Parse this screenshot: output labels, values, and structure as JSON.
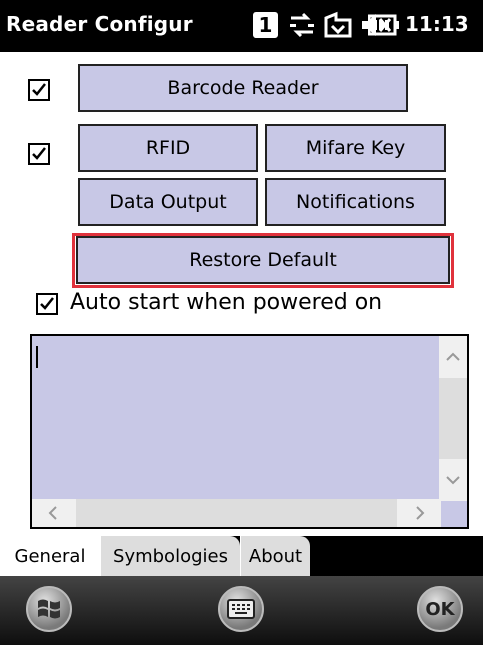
{
  "status_bar": {
    "title": "Reader Configur",
    "notification_count": "1",
    "time": "11:13"
  },
  "form": {
    "barcode_reader_checked": true,
    "barcode_reader_label": "Barcode Reader",
    "rfid_checked": true,
    "rfid_label": "RFID",
    "mifare_key_label": "Mifare Key",
    "data_output_label": "Data Output",
    "notifications_label": "Notifications",
    "restore_default_label": "Restore Default",
    "auto_start_checked": true,
    "auto_start_label": "Auto start when powered on"
  },
  "log": {
    "value": ""
  },
  "tabs": [
    {
      "label": "General",
      "active": true
    },
    {
      "label": "Symbologies",
      "active": false
    },
    {
      "label": "About",
      "active": false
    }
  ],
  "bottom_bar": {
    "ok_label": "OK"
  },
  "colors": {
    "button_fill": "#c8c8e6",
    "highlight": "#e0323c",
    "bar_bg": "#000000"
  }
}
